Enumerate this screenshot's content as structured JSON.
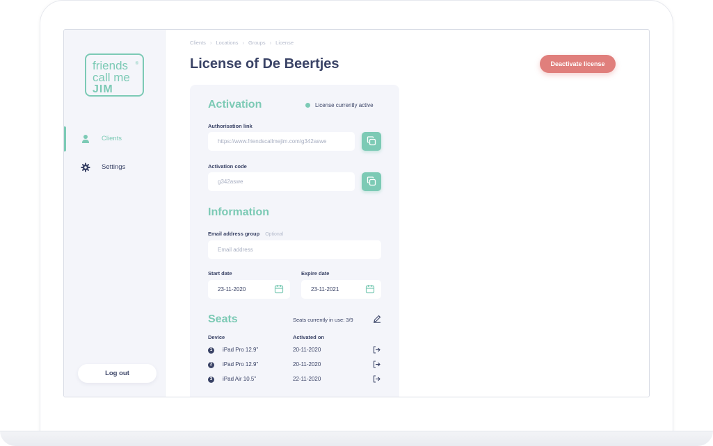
{
  "logo": {
    "line1": "friends",
    "line2": "call me",
    "line3": "JIM",
    "reg": "®"
  },
  "sidebar": {
    "items": [
      {
        "label": "Clients",
        "icon": "user-icon",
        "active": true
      },
      {
        "label": "Settings",
        "icon": "gear-icon",
        "active": false
      }
    ],
    "logout_label": "Log out"
  },
  "breadcrumb": [
    "Clients",
    "Locations",
    "Groups",
    "License"
  ],
  "page": {
    "title": "License of De Beertjes",
    "deactivate_label": "Deactivate license"
  },
  "activation": {
    "title": "Activation",
    "status": "License currently active",
    "auth_link_label": "Authorisation link",
    "auth_link_value": "https://www.friendscallmejim.com/g342aswe",
    "code_label": "Activation code",
    "code_value": "g342aswe"
  },
  "information": {
    "title": "Information",
    "email_label": "Email address group",
    "email_optional": "Optional",
    "email_placeholder": "Email address",
    "start_label": "Start date",
    "start_value": "23-11-2020",
    "expire_label": "Expire date",
    "expire_value": "23-11-2021"
  },
  "seats": {
    "title": "Seats",
    "in_use": "Seats currently in use: 3/9",
    "col_device": "Device",
    "col_activated": "Activated on",
    "rows": [
      {
        "num": "1",
        "device": "iPad Pro 12.9\"",
        "date": "20-11-2020"
      },
      {
        "num": "2",
        "device": "iPad Pro 12.9\"",
        "date": "20-11-2020"
      },
      {
        "num": "3",
        "device": "iPad Air 10.5\"",
        "date": "22-11-2020"
      }
    ]
  },
  "colors": {
    "accent": "#7ccab5",
    "danger": "#e07f7c",
    "text": "#3a4366",
    "panel": "#f4f5fa"
  }
}
